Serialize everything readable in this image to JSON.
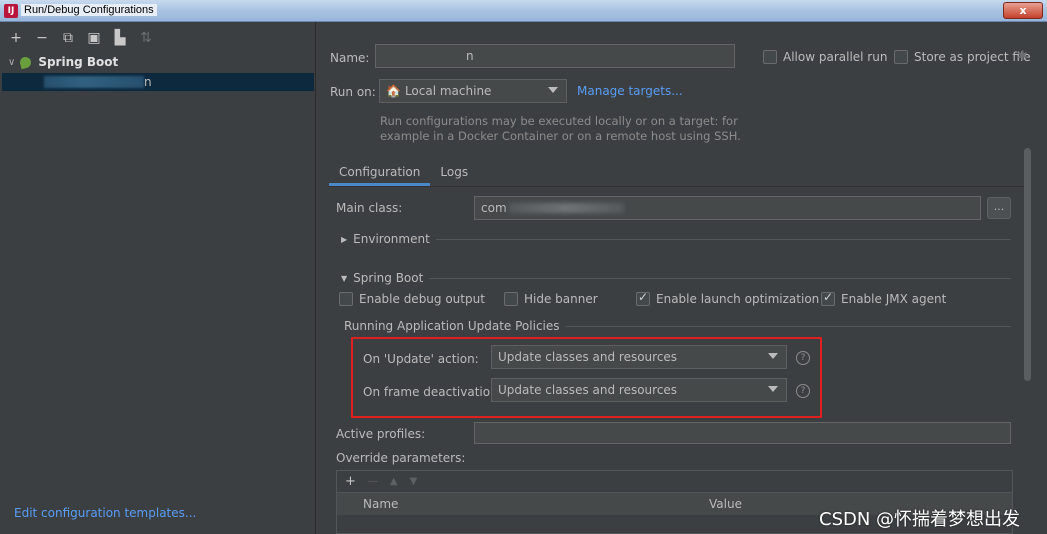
{
  "window": {
    "title": "Run/Debug Configurations",
    "close_label": "x"
  },
  "sidebar": {
    "toolbar": [
      "+",
      "−",
      "⧉",
      "💾",
      "⇥",
      "⇅"
    ],
    "tree_root": "Spring Boot",
    "tree_item_suffix": "n",
    "edit_templates": "Edit configuration templates..."
  },
  "form": {
    "name_label": "Name:",
    "name_value_suffix": "n",
    "allow_parallel": "Allow parallel run",
    "store_project": "Store as project file",
    "run_on_label": "Run on:",
    "run_on_value": "Local machine",
    "manage_targets": "Manage targets...",
    "hint_line1": "Run configurations may be executed locally or on a target: for",
    "hint_line2": "example in a Docker Container or on a remote host using SSH."
  },
  "tabs": [
    {
      "label": "Configuration",
      "active": true
    },
    {
      "label": "Logs",
      "active": false
    }
  ],
  "config": {
    "main_class_label": "Main class:",
    "main_class_value": "com",
    "dots": "...",
    "environment": "Environment",
    "spring_boot": "Spring Boot",
    "checkboxes": [
      {
        "label": "Enable debug output",
        "checked": false
      },
      {
        "label": "Hide banner",
        "checked": false
      },
      {
        "label": "Enable launch optimization",
        "checked": true
      },
      {
        "label": "Enable JMX agent",
        "checked": true
      }
    ],
    "update_policies": "Running Application Update Policies",
    "on_update_label": "On 'Update' action:",
    "on_update_value": "Update classes and resources",
    "on_frame_label": "On frame deactivation:",
    "on_frame_value": "Update classes and resources",
    "active_profiles": "Active profiles:",
    "override_params": "Override parameters:",
    "table_cols": [
      "Name",
      "Value"
    ],
    "help": "?"
  },
  "watermark": "CSDN @怀揣着梦想出发",
  "colors": {
    "accent": "#589df6",
    "tab_underline": "#4a88c7",
    "highlight_box": "#e02020",
    "selection": "#0d293e"
  }
}
